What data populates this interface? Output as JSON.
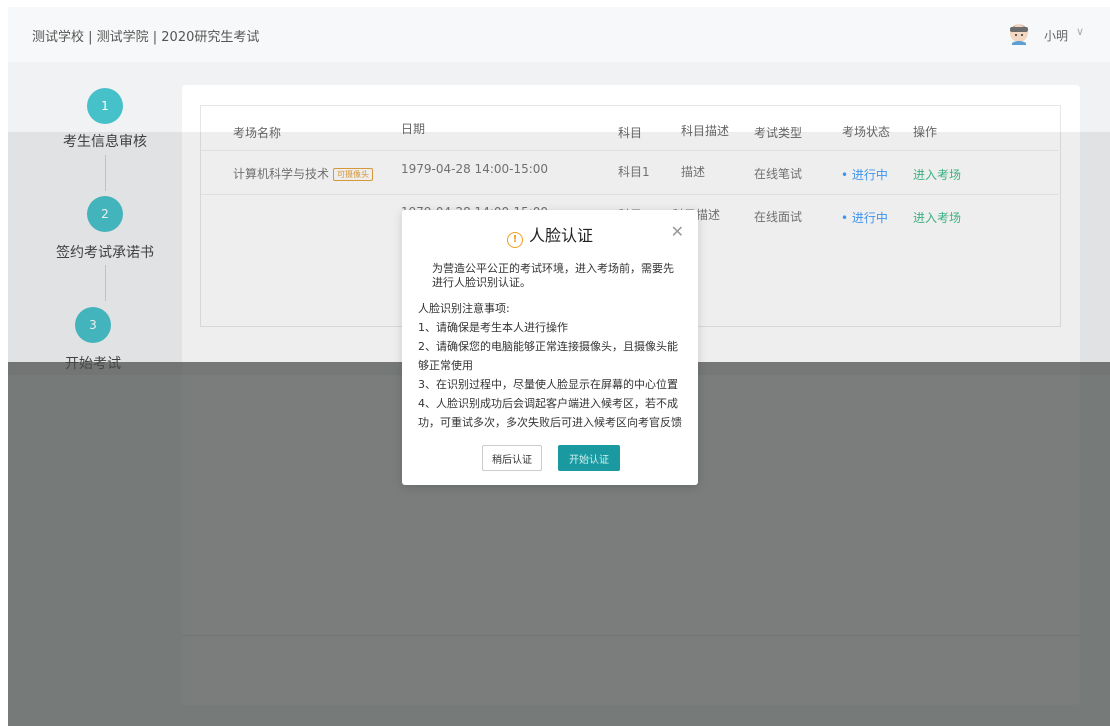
{
  "header": {
    "title": "测试学校 | 测试学院 | 2020研究生考试",
    "user_name": "小明"
  },
  "steps": [
    {
      "number": "1",
      "label": "考生信息审核"
    },
    {
      "number": "2",
      "label": "签约考试承诺书"
    },
    {
      "number": "3",
      "label": "开始考试"
    }
  ],
  "table": {
    "columns": [
      "考场名称",
      "日期",
      "科目",
      "科目描述",
      "考试类型",
      "考场状态",
      "操作"
    ],
    "rows": [
      {
        "name": "计算机科学与技术",
        "badge": "可摄像头",
        "date": "1979-04-28 14:00-15:00",
        "subject": "科目1",
        "desc": "描述",
        "type": "在线笔试",
        "status": "• 进行中",
        "action": "进入考场"
      },
      {
        "name": "",
        "badge": "",
        "date": "1979-04-28 14:00-15:00",
        "subject": "科目2",
        "desc": "科目描述",
        "type": "在线面试",
        "status": "• 进行中",
        "action": "进入考场"
      }
    ]
  },
  "dialog": {
    "title": "人脸认证",
    "intro": "为营造公平公正的考试环境，进入考场前，需要先进行人脸识别认证。",
    "notes_heading": "人脸识别注意事项:",
    "notes": [
      "1、请确保是考生本人进行操作",
      "2、请确保您的电脑能够正常连接摄像头，且摄像头能够正常使用",
      "3、在识别过程中，尽量使人脸显示在屏幕的中心位置",
      "4、人脸识别成功后会调起客户端进入候考区，若不成功，可重试多次，多次失败后可进入候考区向考官反馈"
    ],
    "later_label": "稍后认证",
    "start_label": "开始认证"
  },
  "colors": {
    "accent": "#46c1c9",
    "primary_button": "#1a9aa0",
    "status": "#409eff",
    "action": "#3ebd8b",
    "warning": "#f0a020"
  }
}
